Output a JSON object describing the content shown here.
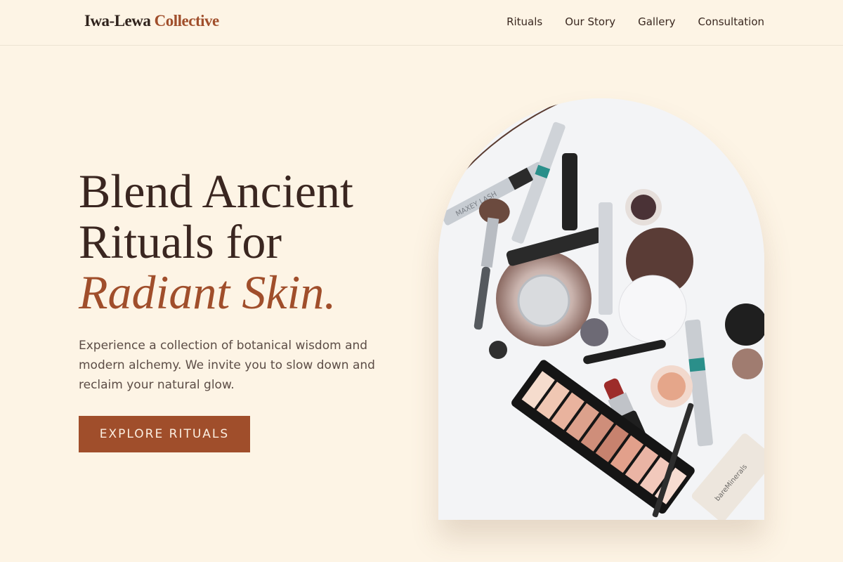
{
  "header": {
    "logo_main": "Iwa-Lewa",
    "logo_accent": "Collective",
    "nav": [
      "Rituals",
      "Our Story",
      "Gallery",
      "Consultation"
    ]
  },
  "hero": {
    "headline_line1": "Blend Ancient",
    "headline_line2": "Rituals for",
    "headline_emphasis": "Radiant Skin.",
    "lede": "Experience a collection of botanical wisdom and modern alchemy. We invite you to slow down and reclaim your natural glow.",
    "cta_label": "EXPLORE RITUALS"
  },
  "image": {
    "brand_text": "MAXEY LASH",
    "tube_text": "bareMinerals"
  },
  "colors": {
    "background": "#fdf4e5",
    "accent": "#a04e2b",
    "text_dark": "#3a2620",
    "text_muted": "#5c4d46"
  }
}
